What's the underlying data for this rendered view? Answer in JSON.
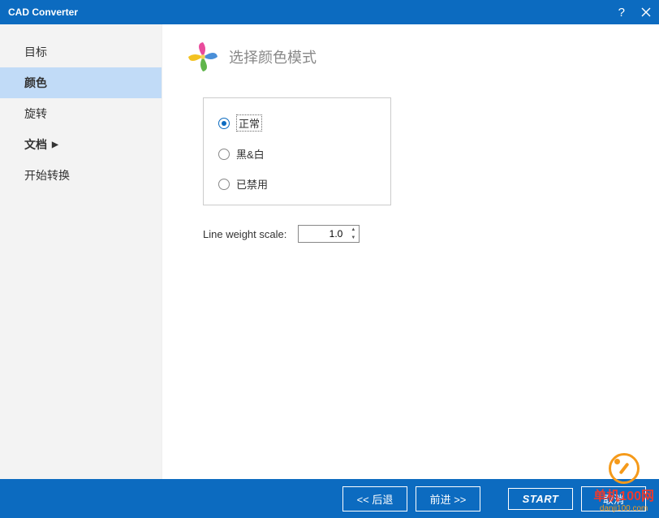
{
  "window": {
    "title": "CAD Converter"
  },
  "sidebar": {
    "items": [
      {
        "label": "目标"
      },
      {
        "label": "颜色"
      },
      {
        "label": "旋转"
      },
      {
        "label": "文档"
      },
      {
        "label": "开始转换"
      }
    ]
  },
  "page": {
    "title": "选择颜色模式"
  },
  "options": {
    "radios": [
      {
        "label": "正常",
        "checked": true
      },
      {
        "label": "黑&白",
        "checked": false
      },
      {
        "label": "已禁用",
        "checked": false
      }
    ]
  },
  "scale": {
    "label": "Line weight scale:",
    "value": "1.0"
  },
  "footer": {
    "back": "<<  后退",
    "forward": "前进  >>",
    "start": "START",
    "cancel": "取消"
  },
  "watermark": {
    "text": "单机100网",
    "sub": "danji100.com"
  }
}
